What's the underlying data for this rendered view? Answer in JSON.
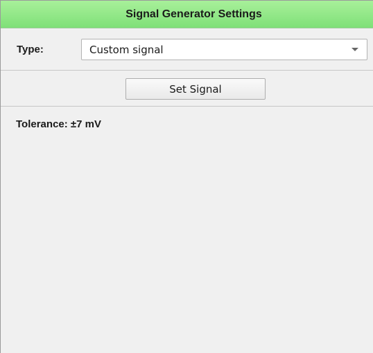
{
  "panel": {
    "title": "Signal Generator Settings",
    "title_bar_color": "#8ee682"
  },
  "type_row": {
    "label": "Type:",
    "selected_value": "Custom signal",
    "dropdown_icon": "chevron-down-icon"
  },
  "actions": {
    "set_signal_label": "Set Signal"
  },
  "status": {
    "tolerance_text": "Tolerance: ±7 mV"
  }
}
